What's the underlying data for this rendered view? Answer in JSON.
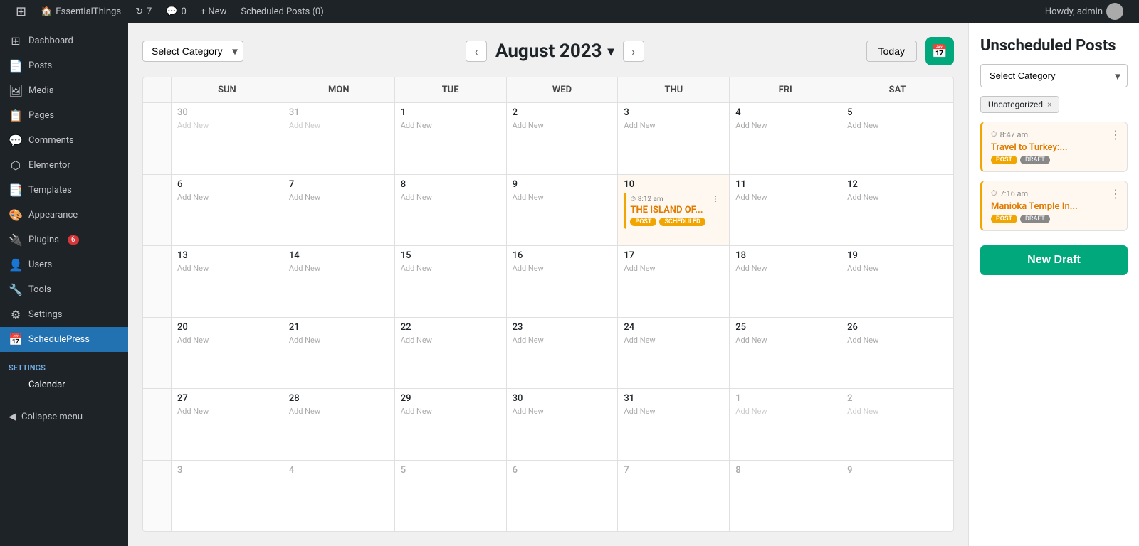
{
  "adminbar": {
    "logo": "⊞",
    "site_name": "EssentialThings",
    "updates_count": "7",
    "comments_count": "0",
    "new_label": "+ New",
    "scheduled_label": "Scheduled Posts (0)",
    "howdy": "Howdy, admin"
  },
  "sidebar": {
    "items": [
      {
        "id": "dashboard",
        "label": "Dashboard",
        "icon": "⊞"
      },
      {
        "id": "posts",
        "label": "Posts",
        "icon": "📄"
      },
      {
        "id": "media",
        "label": "Media",
        "icon": "🖼"
      },
      {
        "id": "pages",
        "label": "Pages",
        "icon": "📋"
      },
      {
        "id": "comments",
        "label": "Comments",
        "icon": "💬"
      },
      {
        "id": "elementor",
        "label": "Elementor",
        "icon": "⬡"
      },
      {
        "id": "templates",
        "label": "Templates",
        "icon": "📑"
      },
      {
        "id": "appearance",
        "label": "Appearance",
        "icon": "🎨"
      },
      {
        "id": "plugins",
        "label": "Plugins",
        "icon": "🔌",
        "badge": "6"
      },
      {
        "id": "users",
        "label": "Users",
        "icon": "👤"
      },
      {
        "id": "tools",
        "label": "Tools",
        "icon": "🔧"
      },
      {
        "id": "settings",
        "label": "Settings",
        "icon": "⚙"
      }
    ],
    "active": "schedulepress",
    "schedulepress_label": "SchedulePress",
    "schedulepress_icon": "📅",
    "settings_label": "Settings",
    "calendar_label": "Calendar",
    "collapse_label": "Collapse menu"
  },
  "calendar": {
    "select_category_placeholder": "Select Category",
    "month_title": "August 2023",
    "today_btn": "Today",
    "day_headers": [
      "SUN",
      "MON",
      "TUE",
      "WED",
      "THU",
      "FRI",
      "SAT"
    ],
    "weeks": [
      {
        "days": [
          {
            "num": "30",
            "other": true,
            "add_new": "Add New"
          },
          {
            "num": "31",
            "other": true,
            "add_new": "Add New"
          },
          {
            "num": "1",
            "add_new": "Add New"
          },
          {
            "num": "2",
            "add_new": "Add New"
          },
          {
            "num": "3",
            "add_new": "Add New"
          },
          {
            "num": "4",
            "add_new": "Add New"
          },
          {
            "num": "5",
            "add_new": "Add New"
          }
        ]
      },
      {
        "days": [
          {
            "num": "6",
            "add_new": "Add New"
          },
          {
            "num": "7",
            "add_new": "Add New"
          },
          {
            "num": "8",
            "add_new": "Add New"
          },
          {
            "num": "9",
            "add_new": "Add New"
          },
          {
            "num": "10",
            "add_new": "Add New",
            "event": {
              "time": "8:12 am",
              "title": "THE ISLAND OF...",
              "badge1": "POST",
              "badge2": "SCHEDULED"
            }
          },
          {
            "num": "11",
            "add_new": "Add New"
          },
          {
            "num": "12",
            "add_new": "Add New"
          }
        ]
      },
      {
        "days": [
          {
            "num": "13",
            "add_new": "Add New"
          },
          {
            "num": "14",
            "add_new": "Add New"
          },
          {
            "num": "15",
            "add_new": "Add New"
          },
          {
            "num": "16",
            "add_new": "Add New"
          },
          {
            "num": "17",
            "add_new": "Add New"
          },
          {
            "num": "18",
            "add_new": "Add New"
          },
          {
            "num": "19",
            "add_new": "Add New"
          }
        ]
      },
      {
        "days": [
          {
            "num": "20",
            "add_new": "Add New"
          },
          {
            "num": "21",
            "add_new": "Add New"
          },
          {
            "num": "22",
            "add_new": "Add New"
          },
          {
            "num": "23",
            "add_new": "Add New"
          },
          {
            "num": "24",
            "add_new": "Add New"
          },
          {
            "num": "25",
            "add_new": "Add New"
          },
          {
            "num": "26",
            "add_new": "Add New"
          }
        ]
      },
      {
        "days": [
          {
            "num": "27",
            "add_new": "Add New"
          },
          {
            "num": "28",
            "add_new": "Add New"
          },
          {
            "num": "29",
            "add_new": "Add New"
          },
          {
            "num": "30",
            "add_new": "Add New"
          },
          {
            "num": "31",
            "add_new": "Add New"
          },
          {
            "num": "1",
            "other": true,
            "add_new": "Add New"
          },
          {
            "num": "2",
            "other": true,
            "add_new": "Add New"
          }
        ]
      },
      {
        "days": [
          {
            "num": "3",
            "other": true
          },
          {
            "num": "4",
            "other": true
          },
          {
            "num": "5",
            "other": true
          },
          {
            "num": "6",
            "other": true
          },
          {
            "num": "7",
            "other": true
          },
          {
            "num": "8",
            "other": true
          },
          {
            "num": "9",
            "other": true
          }
        ]
      }
    ]
  },
  "right_panel": {
    "title": "Unscheduled Posts",
    "select_category_placeholder": "Select Category",
    "filter_tag": "Uncategorized",
    "cards": [
      {
        "time": "8:47 am",
        "title": "Travel to Turkey:...",
        "badge1": "POST",
        "badge2": "DRAFT"
      },
      {
        "time": "7:16 am",
        "title": "Manioka Temple In...",
        "badge1": "POST",
        "badge2": "DRAFT"
      }
    ],
    "new_draft_btn": "New Draft"
  }
}
